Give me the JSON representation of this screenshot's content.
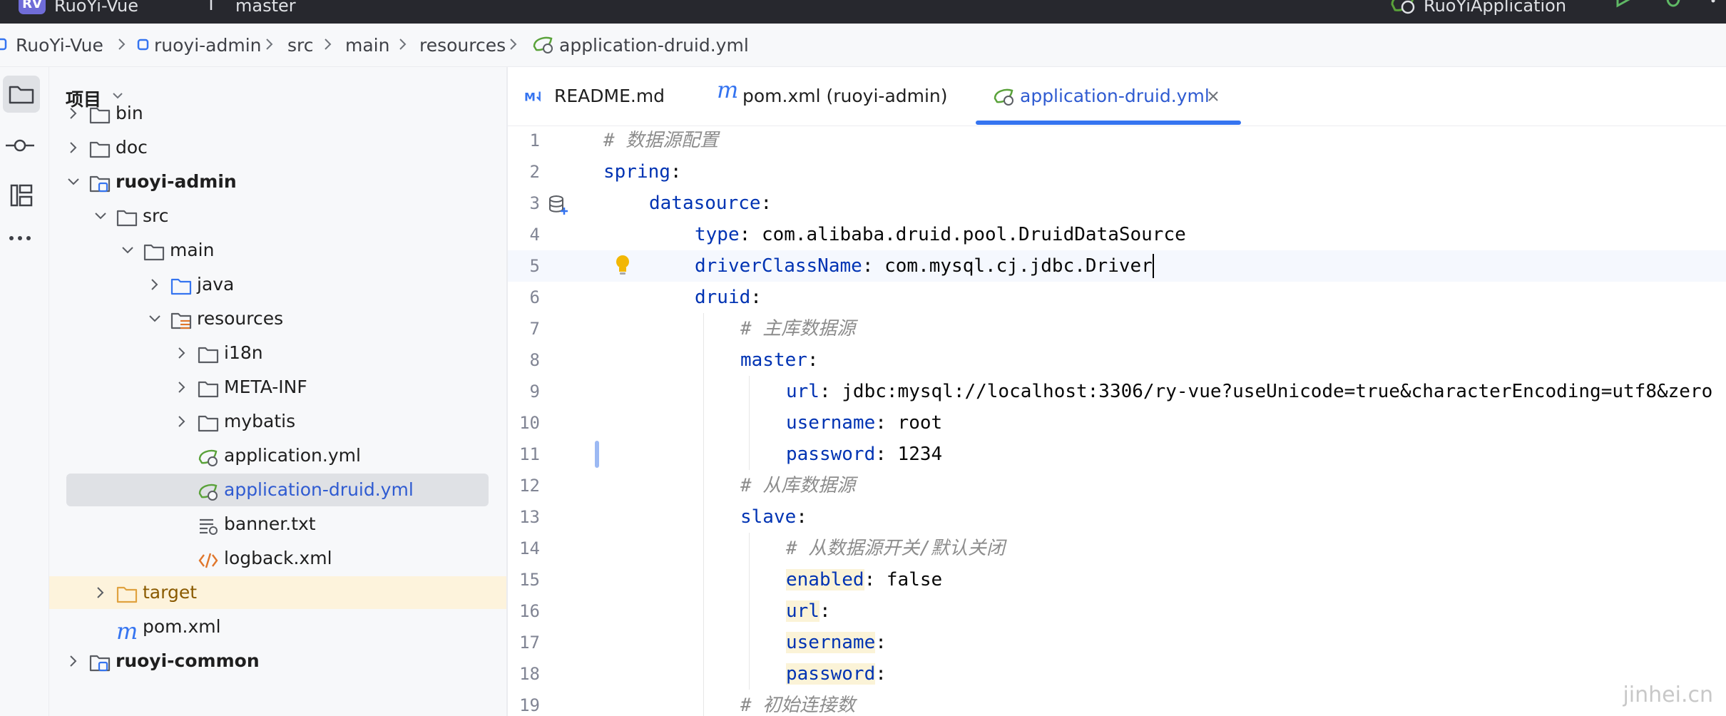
{
  "titlebar": {
    "project_badge": "RV",
    "project_name": "RuoYi-Vue",
    "branch": "master",
    "run_config": "RuoYiApplication"
  },
  "breadcrumb": [
    "RuoYi-Vue",
    "ruoyi-admin",
    "src",
    "main",
    "resources",
    "application-druid.yml"
  ],
  "project_panel": {
    "title": "项目",
    "tree": [
      {
        "label": "bin",
        "icon": "folder-icon",
        "expanded": false
      },
      {
        "label": "doc",
        "icon": "folder-icon",
        "expanded": false
      },
      {
        "label": "ruoyi-admin",
        "icon": "module-folder-icon",
        "expanded": true,
        "bold": true
      },
      {
        "label": "src",
        "icon": "folder-icon",
        "expanded": true
      },
      {
        "label": "main",
        "icon": "folder-icon",
        "expanded": true
      },
      {
        "label": "java",
        "icon": "source-folder-icon",
        "expanded": false
      },
      {
        "label": "resources",
        "icon": "resources-folder-icon",
        "expanded": true
      },
      {
        "label": "i18n",
        "icon": "folder-icon",
        "expanded": false
      },
      {
        "label": "META-INF",
        "icon": "folder-icon",
        "expanded": false
      },
      {
        "label": "mybatis",
        "icon": "folder-icon",
        "expanded": false
      },
      {
        "label": "application.yml",
        "icon": "spring-yaml-icon"
      },
      {
        "label": "application-druid.yml",
        "icon": "spring-yaml-icon",
        "selected": true
      },
      {
        "label": "banner.txt",
        "icon": "text-file-icon"
      },
      {
        "label": "logback.xml",
        "icon": "xml-file-icon"
      },
      {
        "label": "target",
        "icon": "excluded-folder-icon",
        "expanded": false,
        "highlighted": true
      },
      {
        "label": "pom.xml",
        "icon": "maven-icon"
      },
      {
        "label": "ruoyi-common",
        "icon": "module-folder-icon",
        "expanded": false,
        "bold": true
      }
    ]
  },
  "tabs": [
    {
      "label": "README.md",
      "icon": "markdown-icon"
    },
    {
      "label": "pom.xml (ruoyi-admin)",
      "icon": "maven-icon"
    },
    {
      "label": "application-druid.yml",
      "icon": "spring-yaml-icon",
      "active": true,
      "closable": true
    }
  ],
  "editor": {
    "lines": [
      {
        "n": "1",
        "indent": 0,
        "comment": "# 数据源配置"
      },
      {
        "n": "2",
        "indent": 0,
        "key": "spring",
        "sep": ":"
      },
      {
        "n": "3",
        "indent": 1,
        "key": "datasource",
        "sep": ":"
      },
      {
        "n": "4",
        "indent": 2,
        "key": "type",
        "sep": ": ",
        "value": "com.alibaba.druid.pool.DruidDataSource"
      },
      {
        "n": "5",
        "indent": 2,
        "key": "driverClassName",
        "sep": ": ",
        "value": "com.mysql.cj.jdbc.Driver"
      },
      {
        "n": "6",
        "indent": 2,
        "key": "druid",
        "sep": ":"
      },
      {
        "n": "7",
        "indent": 3,
        "comment": "# 主库数据源"
      },
      {
        "n": "8",
        "indent": 3,
        "key": "master",
        "sep": ":"
      },
      {
        "n": "9",
        "indent": 4,
        "key": "url",
        "sep": ": ",
        "value": "jdbc:mysql://localhost:3306/ry-vue?useUnicode=true&characterEncoding=utf8&zero"
      },
      {
        "n": "10",
        "indent": 4,
        "key": "username",
        "sep": ": ",
        "value": "root"
      },
      {
        "n": "11",
        "indent": 4,
        "key": "password",
        "sep": ": ",
        "value": "1234"
      },
      {
        "n": "12",
        "indent": 3,
        "comment": "# 从库数据源"
      },
      {
        "n": "13",
        "indent": 3,
        "key": "slave",
        "sep": ":"
      },
      {
        "n": "14",
        "indent": 4,
        "comment": "# 从数据源开关/默认关闭"
      },
      {
        "n": "15",
        "indent": 4,
        "key": "enabled",
        "sep": ": ",
        "value": "false",
        "hl": true
      },
      {
        "n": "16",
        "indent": 4,
        "key": "url",
        "sep": ":",
        "hl": true
      },
      {
        "n": "17",
        "indent": 4,
        "key": "username",
        "sep": ":",
        "hl": true
      },
      {
        "n": "18",
        "indent": 4,
        "key": "password",
        "sep": ":",
        "hl": true
      },
      {
        "n": "19",
        "indent": 3,
        "comment": "# 初始连接数"
      }
    ],
    "current_line": "5"
  },
  "watermark": "jinhei.cn",
  "colors": {
    "accent": "#3574f0",
    "yaml_key": "#0033b3",
    "comment": "#8c8c8c",
    "folder_excluded": "#e0a23f",
    "spring_green": "#5aa23a"
  }
}
